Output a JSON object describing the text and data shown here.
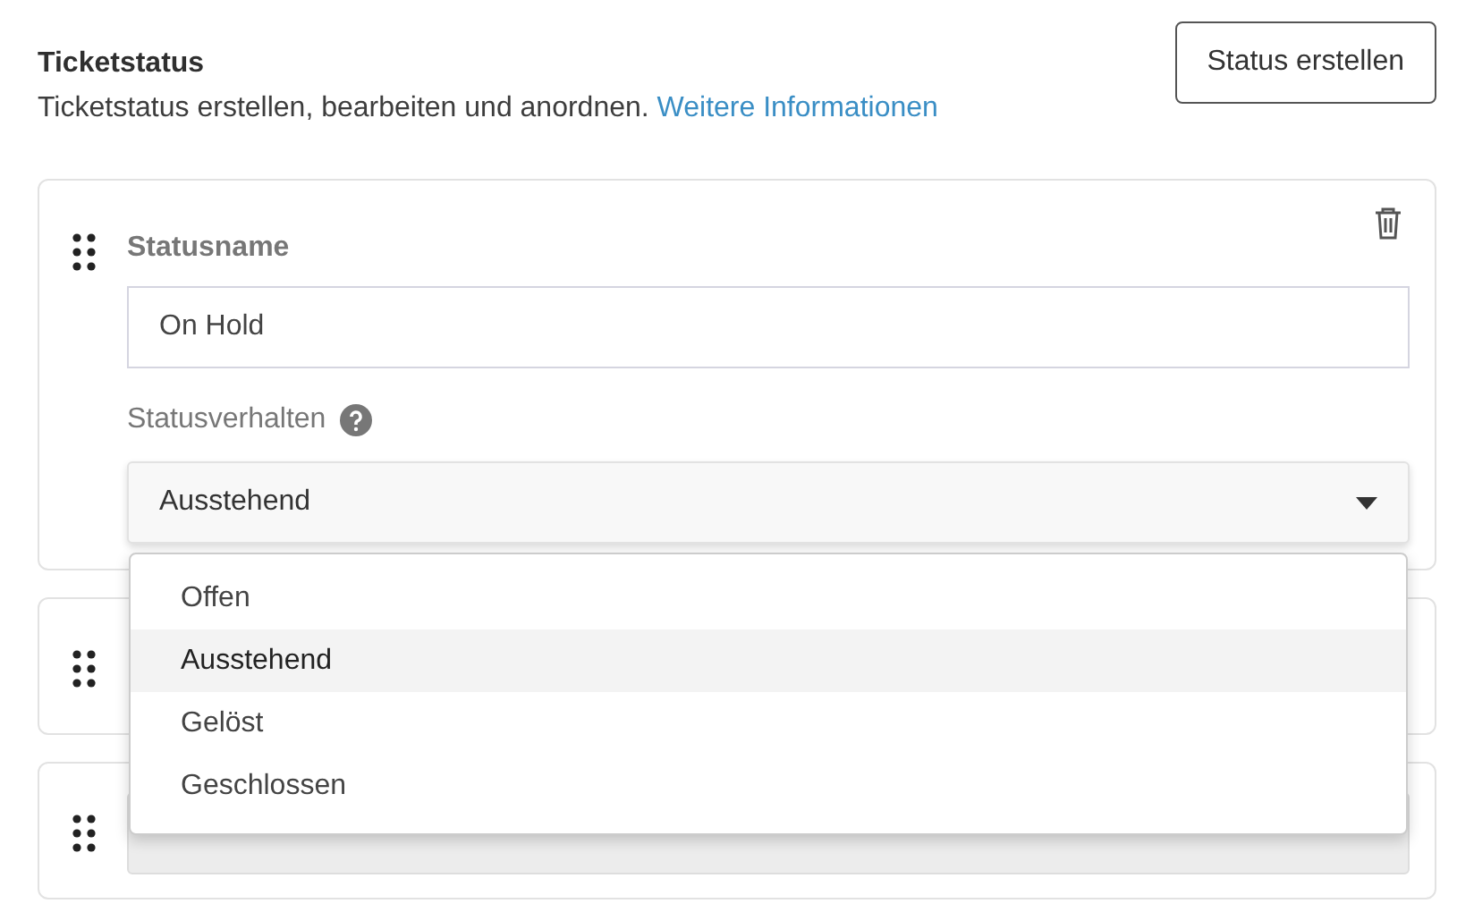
{
  "header": {
    "title": "Ticketstatus",
    "description": "Ticketstatus erstellen, bearbeiten und anordnen.",
    "link": "Weitere Informationen",
    "create_button": "Status erstellen"
  },
  "statuses": [
    {
      "kind": "editing",
      "name_label": "Statusname",
      "name_value": "On Hold",
      "behavior_label": "Statusverhalten",
      "behavior_value": "Ausstehend",
      "menu_open": true,
      "options": [
        {
          "label": "Offen",
          "selected": false
        },
        {
          "label": "Ausstehend",
          "selected": true
        },
        {
          "label": "Gelöst",
          "selected": false
        },
        {
          "label": "Geschlossen",
          "selected": false
        }
      ]
    },
    {
      "kind": "collapsed"
    },
    {
      "kind": "covered_row"
    }
  ]
}
